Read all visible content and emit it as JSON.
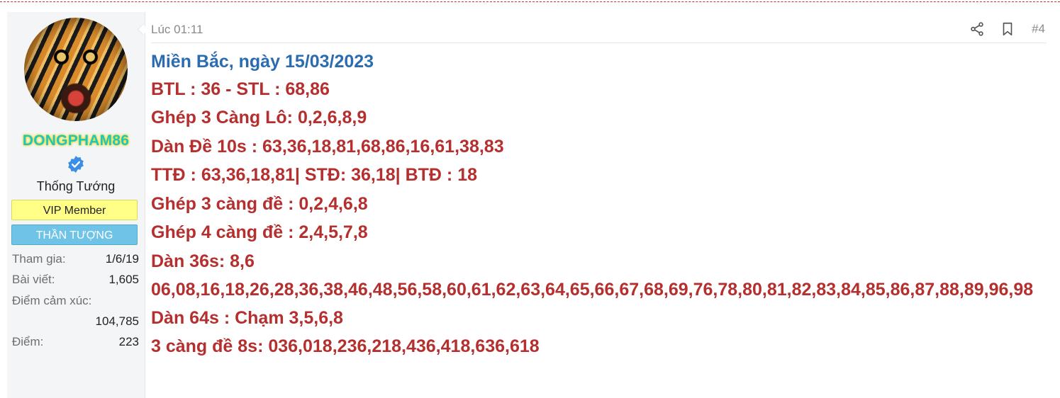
{
  "user": {
    "username": "DONGPHAM86",
    "title": "Thống Tướng",
    "banners": [
      "VIP Member",
      "THẦN TƯỢNG"
    ],
    "stats": [
      {
        "label": "Tham gia:",
        "value": "1/6/19"
      },
      {
        "label": "Bài viết:",
        "value": "1,605"
      },
      {
        "label": "Điểm cảm xúc:",
        "value": "104,785"
      },
      {
        "label": "Điểm:",
        "value": "223"
      }
    ]
  },
  "post": {
    "time": "Lúc 01:11",
    "number": "#4",
    "heading": "Miền Bắc, ngày 15/03/2023",
    "lines": [
      "BTL : 36 - STL : 68,86",
      "Ghép 3 Càng Lô: 0,2,6,8,9",
      "Dàn Đề 10s : 63,36,18,81,68,86,16,61,38,83",
      "TTĐ : 63,36,18,81| STĐ: 36,18| BTĐ : 18",
      "Ghép 3 càng đề : 0,2,4,6,8",
      "Ghép 4 càng đề : 2,4,5,7,8",
      "Dàn 36s: 8,6",
      "06,08,16,18,26,28,36,38,46,48,56,58,60,61,62,63,64,65,66,67,68,69,76,78,80,81,82,83,84,85,86,87,88,89,96,98",
      "Dàn 64s : Chạm 3,5,6,8",
      "3 càng đề 8s: 036,018,236,218,436,418,636,618"
    ]
  },
  "icons": {
    "share": "share-icon",
    "bookmark": "bookmark-icon",
    "verified": "verified-badge-icon"
  },
  "colors": {
    "body_text": "#b52f2f",
    "heading": "#2b6cb0",
    "username": "#1cc6c6",
    "vip_banner": "#ffff88",
    "idol_banner": "#6ec3e6"
  }
}
